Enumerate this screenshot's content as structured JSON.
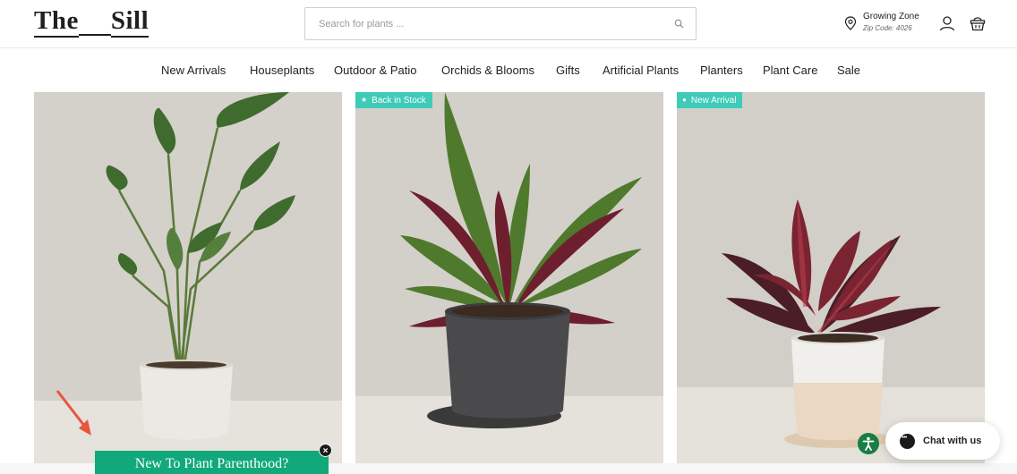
{
  "brand": {
    "logo_left": "The",
    "logo_right": "Sill"
  },
  "search": {
    "placeholder": "Search for plants ..."
  },
  "growing_zone": {
    "title": "Growing Zone",
    "zip": "Zip Code: 4026"
  },
  "nav": {
    "items": [
      "New Arrivals",
      "Houseplants",
      "Outdoor & Patio",
      "Orchids & Blooms",
      "Gifts",
      "Artificial Plants",
      "Planters",
      "Plant Care",
      "Sale"
    ]
  },
  "products": [
    {
      "badge": "",
      "plant": "bird-of-paradise",
      "pot": "white"
    },
    {
      "badge": "Back in Stock",
      "badge_icon": "star-icon",
      "plant": "calathea",
      "pot": "charcoal"
    },
    {
      "badge": "New Arrival",
      "badge_icon": "dot-icon",
      "plant": "rubber-tree",
      "pot": "two-tone"
    }
  ],
  "popup": {
    "title": "New To Plant Parenthood?",
    "close": "×"
  },
  "chat": {
    "label": "Chat with us"
  },
  "colors": {
    "accent": "#3ecbb8",
    "popup_bg": "#11a97a",
    "a11y": "#1a7d43"
  }
}
